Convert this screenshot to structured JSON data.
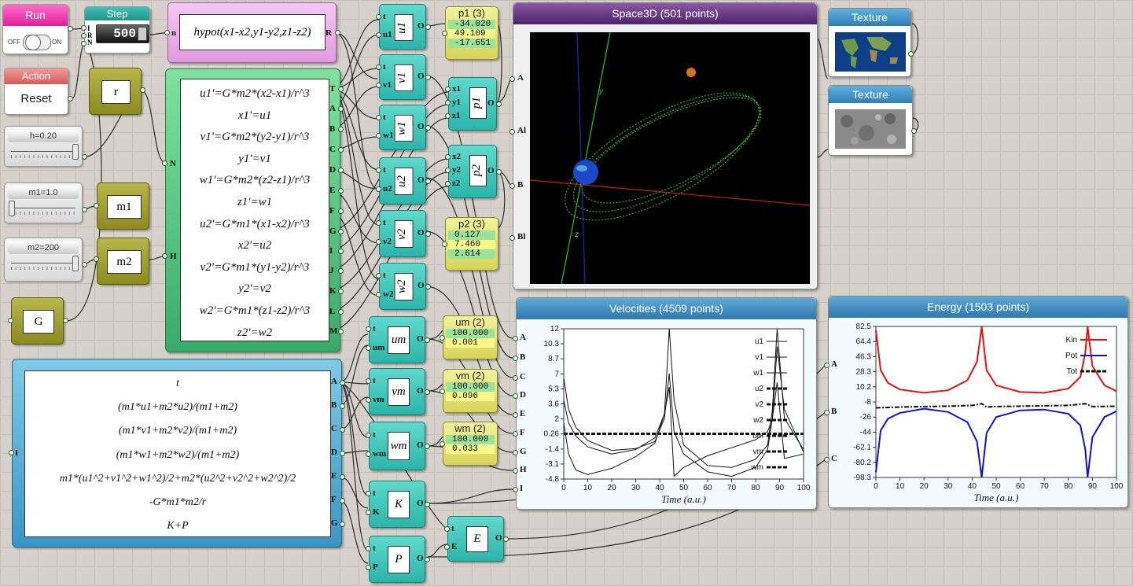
{
  "controls": {
    "run_label": "Run",
    "off_label": "OFF",
    "on_label": "ON",
    "step_title": "Step",
    "step_value": "500",
    "step_ports": [
      "I",
      "R",
      "N"
    ],
    "action_title": "Action",
    "reset_label": "Reset",
    "h_label": "h=0.20",
    "h_level": 1.0,
    "m1_label": "m1=1.0",
    "m1_level": 0.0,
    "m2_label": "m2=200",
    "m2_level": 1.0
  },
  "hypot": {
    "formula": "hypot(x1-x2,y1-y2,z1-z2)",
    "in_port": "n",
    "out_port": "R"
  },
  "olive_blocks": {
    "r": "r",
    "m1": "m1",
    "m2": "m2",
    "G": "G"
  },
  "ode": {
    "in_ports": [
      "N",
      "H"
    ],
    "equations": [
      "u1'=G*m2*(x2-x1)/r^3",
      "x1'=u1",
      "v1'=G*m2*(y2-y1)/r^3",
      "y1'=v1",
      "w1'=G*m2*(z2-z1)/r^3",
      "z1'=w1",
      "u2'=G*m1*(x1-x2)/r^3",
      "x2'=u2",
      "v2'=G*m1*(y1-y2)/r^3",
      "y2'=v2",
      "w2'=G*m1*(z1-z2)/r^3",
      "z2'=w2"
    ],
    "out_ports": [
      "T",
      "A",
      "B",
      "C",
      "D",
      "E",
      "F",
      "G",
      "I",
      "J",
      "K",
      "L",
      "M"
    ]
  },
  "expr": {
    "in_port": "I",
    "lines": [
      "t",
      "(m1*u1+m2*u2)/(m1+m2)",
      "(m1*v1+m2*v2)/(m1+m2)",
      "(m1*w1+m2*w2)/(m1+m2)",
      "m1*(u1^2+v1^2+w1^2)/2+m2*(u2^2+v2^2+w2^2)/2",
      "-G*m1*m2/r",
      "K+P"
    ],
    "out_ports": [
      "A",
      "B",
      "C",
      "D",
      "E",
      "F",
      "G"
    ]
  },
  "series_blocks": [
    {
      "name": "u1",
      "ports": [
        "t",
        "u1"
      ],
      "out": "O"
    },
    {
      "name": "v1",
      "ports": [
        "t",
        "v1"
      ],
      "out": "O"
    },
    {
      "name": "w1",
      "ports": [
        "t",
        "w1"
      ],
      "out": "O"
    },
    {
      "name": "u2",
      "ports": [
        "t",
        "u2"
      ],
      "out": "O"
    },
    {
      "name": "v2",
      "ports": [
        "t",
        "v2"
      ],
      "out": "O"
    },
    {
      "name": "w2",
      "ports": [
        "t",
        "w2"
      ],
      "out": "O"
    },
    {
      "name": "um",
      "ports": [
        "t",
        "um"
      ],
      "out": "O"
    },
    {
      "name": "vm",
      "ports": [
        "t",
        "vm"
      ],
      "out": "O"
    },
    {
      "name": "wm",
      "ports": [
        "t",
        "wm"
      ],
      "out": "O"
    },
    {
      "name": "K",
      "ports": [
        "t",
        "K"
      ],
      "out": "O"
    },
    {
      "name": "P",
      "ports": [
        "t",
        "P"
      ],
      "out": "O"
    },
    {
      "name": "E",
      "ports": [
        "t",
        "E"
      ],
      "out": "O"
    }
  ],
  "points_blocks": [
    {
      "name": "p1",
      "ports": [
        "x1",
        "y1",
        "z1"
      ],
      "out": "O"
    },
    {
      "name": "p2",
      "ports": [
        "x2",
        "y2",
        "z2"
      ],
      "out": "O"
    }
  ],
  "displays": [
    {
      "title": "p1 (3)",
      "values": [
        "-34.020",
        "49.109",
        "-17.651"
      ]
    },
    {
      "title": "p2 (3)",
      "values": [
        "0.127",
        "7.460",
        "2.614"
      ]
    },
    {
      "title": "um (2)",
      "values": [
        "100.000",
        "0.001"
      ]
    },
    {
      "title": "vm (2)",
      "values": [
        "100.000",
        "0.096"
      ]
    },
    {
      "title": "wm (2)",
      "values": [
        "100.000",
        "0.033"
      ]
    }
  ],
  "space3d": {
    "title": "Space3D (501 points)",
    "ports": [
      "A",
      "Al",
      "B",
      "Bl"
    ],
    "axis_labels": [
      "y",
      "z"
    ]
  },
  "textures": [
    {
      "title": "Texture",
      "kind": "earth-map"
    },
    {
      "title": "Texture",
      "kind": "moon-surface"
    }
  ],
  "colors": {
    "teal": "#2bb5aa",
    "olive": "#8c8b1f",
    "win_title": "#2f86bd",
    "space_title": "#5b2b7a",
    "kin": "#e81010",
    "pot": "#1010d8"
  },
  "chart_data": [
    {
      "type": "line",
      "title": "Velocities (4509 points)",
      "xlabel": "Time (a.u.)",
      "xlim": [
        0,
        100
      ],
      "ylim": [
        -4.8,
        12
      ],
      "xticks": [
        "0",
        "10",
        "20",
        "30",
        "40",
        "50",
        "60",
        "70",
        "80",
        "90",
        "100"
      ],
      "yticks": [
        "12",
        "10.3",
        "8.7",
        "7",
        "5.3",
        "3.6",
        "2",
        "0.26",
        "-1.4",
        "-3.1",
        "-4.8"
      ],
      "ports": [
        "A",
        "B",
        "C",
        "D",
        "E",
        "F",
        "G",
        "H",
        "I"
      ],
      "series": [
        {
          "name": "u1",
          "x": [
            0,
            2,
            5,
            10,
            20,
            30,
            38,
            42,
            44,
            46,
            50,
            60,
            70,
            80,
            85,
            87,
            89,
            92,
            100
          ],
          "y": [
            1.5,
            -2,
            -3.8,
            -4.3,
            -3.6,
            -2.3,
            -0.8,
            2.5,
            12,
            4,
            -1,
            -3.3,
            -3.5,
            -2.6,
            -1,
            3,
            12,
            2,
            -1.5
          ]
        },
        {
          "name": "v1",
          "x": [
            0,
            2,
            5,
            10,
            20,
            30,
            38,
            42,
            44,
            46,
            50,
            60,
            70,
            80,
            85,
            87,
            89,
            92,
            100
          ],
          "y": [
            6.5,
            3,
            1,
            -0.5,
            -1.6,
            -1.4,
            -0.6,
            2,
            7,
            0.5,
            -2,
            -4,
            -4.5,
            -3.5,
            -1.5,
            2,
            10,
            3,
            -1.8
          ]
        },
        {
          "name": "w1",
          "x": [
            0,
            2,
            5,
            10,
            20,
            30,
            38,
            42,
            44,
            46,
            50,
            60,
            70,
            80,
            85,
            87,
            89,
            92,
            100
          ],
          "y": [
            4,
            1.5,
            0,
            -1.2,
            -2,
            -1.5,
            -0.2,
            2.5,
            5.5,
            -4.5,
            -3.5,
            -2.2,
            -1.3,
            -0.4,
            0.5,
            2,
            6,
            -2.5,
            -2
          ]
        },
        {
          "name": "u2",
          "x": [
            0,
            100
          ],
          "y": [
            0.26,
            0.26
          ]
        },
        {
          "name": "v2",
          "x": [
            0,
            100
          ],
          "y": [
            0.26,
            0.26
          ]
        },
        {
          "name": "w2",
          "x": [
            0,
            100
          ],
          "y": [
            0.26,
            0.26
          ]
        },
        {
          "name": "um",
          "x": [
            0,
            100
          ],
          "y": [
            0.26,
            0.26
          ]
        },
        {
          "name": "vm",
          "x": [
            0,
            100
          ],
          "y": [
            0.26,
            0.26
          ]
        },
        {
          "name": "wm",
          "x": [
            0,
            100
          ],
          "y": [
            0.26,
            0.26
          ]
        }
      ]
    },
    {
      "type": "line",
      "title": "Energy (1503 points)",
      "xlabel": "Time (a.u.)",
      "xlim": [
        0,
        100
      ],
      "ylim": [
        -98.3,
        82.5
      ],
      "xticks": [
        "0",
        "10",
        "20",
        "30",
        "40",
        "50",
        "60",
        "70",
        "80",
        "90",
        "100"
      ],
      "yticks": [
        "82.5",
        "64.4",
        "46.3",
        "28.3",
        "10.2",
        "-8",
        "-26",
        "-44",
        "-62.1",
        "-80.2",
        "-98.3"
      ],
      "ports": [
        "A",
        "B",
        "C"
      ],
      "series": [
        {
          "name": "Kin",
          "color": "#e81010",
          "x": [
            0,
            2,
            5,
            10,
            20,
            30,
            38,
            42,
            44,
            46,
            50,
            60,
            70,
            80,
            85,
            87,
            88,
            90,
            95,
            100
          ],
          "y": [
            78,
            30,
            15,
            7,
            3,
            6,
            18,
            40,
            82,
            30,
            12,
            4,
            3,
            8,
            22,
            50,
            82,
            35,
            12,
            5
          ]
        },
        {
          "name": "Pot",
          "color": "#1010d8",
          "x": [
            0,
            2,
            5,
            10,
            20,
            30,
            38,
            42,
            44,
            46,
            50,
            60,
            70,
            80,
            85,
            87,
            88,
            90,
            95,
            100
          ],
          "y": [
            -92,
            -42,
            -28,
            -21,
            -16,
            -20,
            -32,
            -55,
            -98,
            -45,
            -26,
            -18,
            -17,
            -22,
            -36,
            -64,
            -98,
            -50,
            -26,
            -19
          ]
        },
        {
          "name": "Tot",
          "color": "#111111",
          "x": [
            0,
            10,
            20,
            30,
            40,
            44,
            46,
            50,
            60,
            70,
            80,
            87,
            90,
            100
          ],
          "y": [
            -15,
            -14,
            -13.5,
            -13,
            -12,
            -10,
            -14,
            -13.5,
            -13,
            -12.5,
            -12,
            -10,
            -13.5,
            -13
          ]
        }
      ]
    }
  ]
}
